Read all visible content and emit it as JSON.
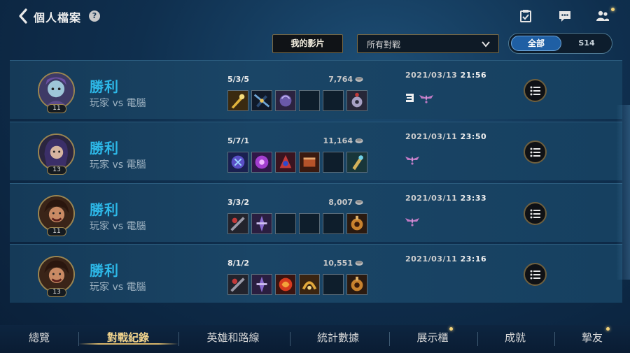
{
  "header": {
    "title": "個人檔案",
    "help_label": "?",
    "icons": [
      "back-chevron-icon",
      "checklist-icon",
      "chat-icon",
      "friends-icon"
    ]
  },
  "filters": {
    "video_button": "我的影片",
    "match_filter_selected": "所有對戰",
    "season_toggle": {
      "active": "全部",
      "inactive": "S14"
    }
  },
  "matches": [
    {
      "level": "11",
      "result": "勝利",
      "mode": "玩家 vs 電腦",
      "kda": "5/3/5",
      "gold": "7,764",
      "date": "2021/03/13",
      "time": "21:56",
      "badges": [
        "triple-kill-badge",
        "rank-wings-badge"
      ]
    },
    {
      "level": "13",
      "result": "勝利",
      "mode": "玩家 vs 電腦",
      "kda": "5/7/1",
      "gold": "11,164",
      "date": "2021/03/11",
      "time": "23:50",
      "badges": [
        "rank-wings-badge"
      ]
    },
    {
      "level": "11",
      "result": "勝利",
      "mode": "玩家 vs 電腦",
      "kda": "3/3/2",
      "gold": "8,007",
      "date": "2021/03/11",
      "time": "23:33",
      "badges": [
        "rank-wings-badge"
      ]
    },
    {
      "level": "13",
      "result": "勝利",
      "mode": "玩家 vs 電腦",
      "kda": "8/1/2",
      "gold": "10,551",
      "date": "2021/03/11",
      "time": "23:16",
      "badges": []
    }
  ],
  "nav": {
    "tabs": [
      "總覽",
      "對戰紀錄",
      "英雄和路線",
      "統計數據",
      "展示櫃",
      "成就",
      "摯友"
    ],
    "active": "對戰紀錄"
  },
  "colors": {
    "accent_gold": "#d7b66a",
    "win_blue": "#2db8e8",
    "toggle_active": "#1f5fa4"
  }
}
